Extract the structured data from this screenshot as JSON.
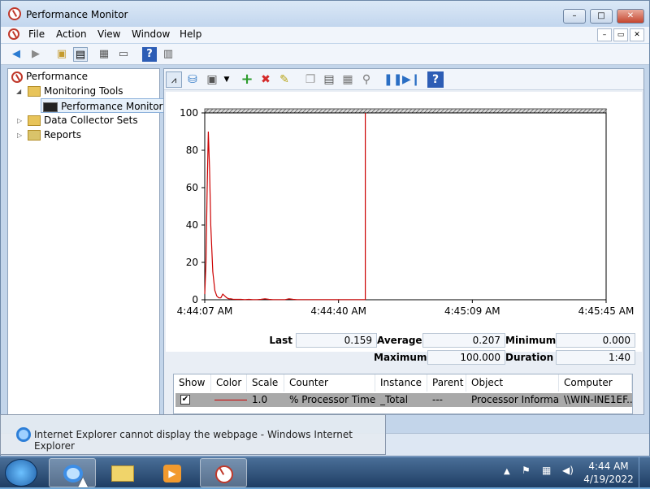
{
  "window": {
    "title": "Performance Monitor",
    "controls": {
      "minimize": "–",
      "maximize": "□",
      "close": "✕"
    }
  },
  "menu": [
    "File",
    "Action",
    "View",
    "Window",
    "Help"
  ],
  "mdi_controls": {
    "minimize": "–",
    "restore": "▭",
    "close": "✕"
  },
  "tree": {
    "root": "Performance",
    "monitoring_tools": "Monitoring Tools",
    "performance_monitor": "Performance Monitor",
    "data_collector_sets": "Data Collector Sets",
    "reports": "Reports"
  },
  "chart_data": {
    "type": "line",
    "series": [
      {
        "name": "% Processor Time",
        "color": "#cc0000",
        "x": [
          0,
          0.3,
          0.6,
          0.9,
          1.2,
          1.5,
          2.0,
          2.5,
          3.0,
          3.5,
          4.0,
          4.5,
          5.0,
          5.5,
          6.0,
          6.5,
          7.0,
          8,
          9,
          10,
          11,
          12,
          13,
          14,
          15,
          16,
          17,
          18,
          19,
          20,
          21,
          22,
          23,
          24,
          25,
          26,
          27,
          28,
          29,
          30,
          31,
          32,
          33,
          34,
          35,
          36,
          37,
          38,
          39,
          40
        ],
        "values": [
          3,
          20,
          60,
          90,
          70,
          40,
          15,
          5,
          2,
          1,
          1,
          3,
          2,
          1,
          0.5,
          0.5,
          0.3,
          0.2,
          0.2,
          0.1,
          0.2,
          0.1,
          0.1,
          0.2,
          0.5,
          0.2,
          0.1,
          0.1,
          0.1,
          0.1,
          0.5,
          0.2,
          0.1,
          0.1,
          0.1,
          0.1,
          0.1,
          0.1,
          0.1,
          0.1,
          0.1,
          0.1,
          0.1,
          0.1,
          0.1,
          0.1,
          0.1,
          0.1,
          0.1,
          0.1
        ]
      }
    ],
    "ylim": [
      0,
      100
    ],
    "yticks": [
      "100",
      "80",
      "60",
      "40",
      "20",
      "0"
    ],
    "xticks": [
      "4:44:07 AM",
      "4:44:40 AM",
      "4:45:09 AM",
      "4:45:45 AM"
    ],
    "cursor_x": 40,
    "grid": false
  },
  "stats": {
    "last_label": "Last",
    "last_value": "0.159",
    "average_label": "Average",
    "average_value": "0.207",
    "minimum_label": "Minimum",
    "minimum_value": "0.000",
    "maximum_label": "Maximum",
    "maximum_value": "100.000",
    "duration_label": "Duration",
    "duration_value": "1:40"
  },
  "counter_table": {
    "headers": [
      "Show",
      "Color",
      "Scale",
      "Counter",
      "Instance",
      "Parent",
      "Object",
      "Computer"
    ],
    "row": {
      "show": "✔",
      "color": "#cc0000",
      "scale": "1.0",
      "counter": "% Processor Time",
      "instance": "_Total",
      "parent": "---",
      "object": "Processor Informa...",
      "computer": "\\\\WIN-INE1EF..."
    }
  },
  "thumbnail": {
    "text": "Internet Explorer cannot display the webpage - Windows Internet Explorer"
  },
  "taskbar": {
    "time": "4:44 AM",
    "date": "4/19/2022"
  }
}
